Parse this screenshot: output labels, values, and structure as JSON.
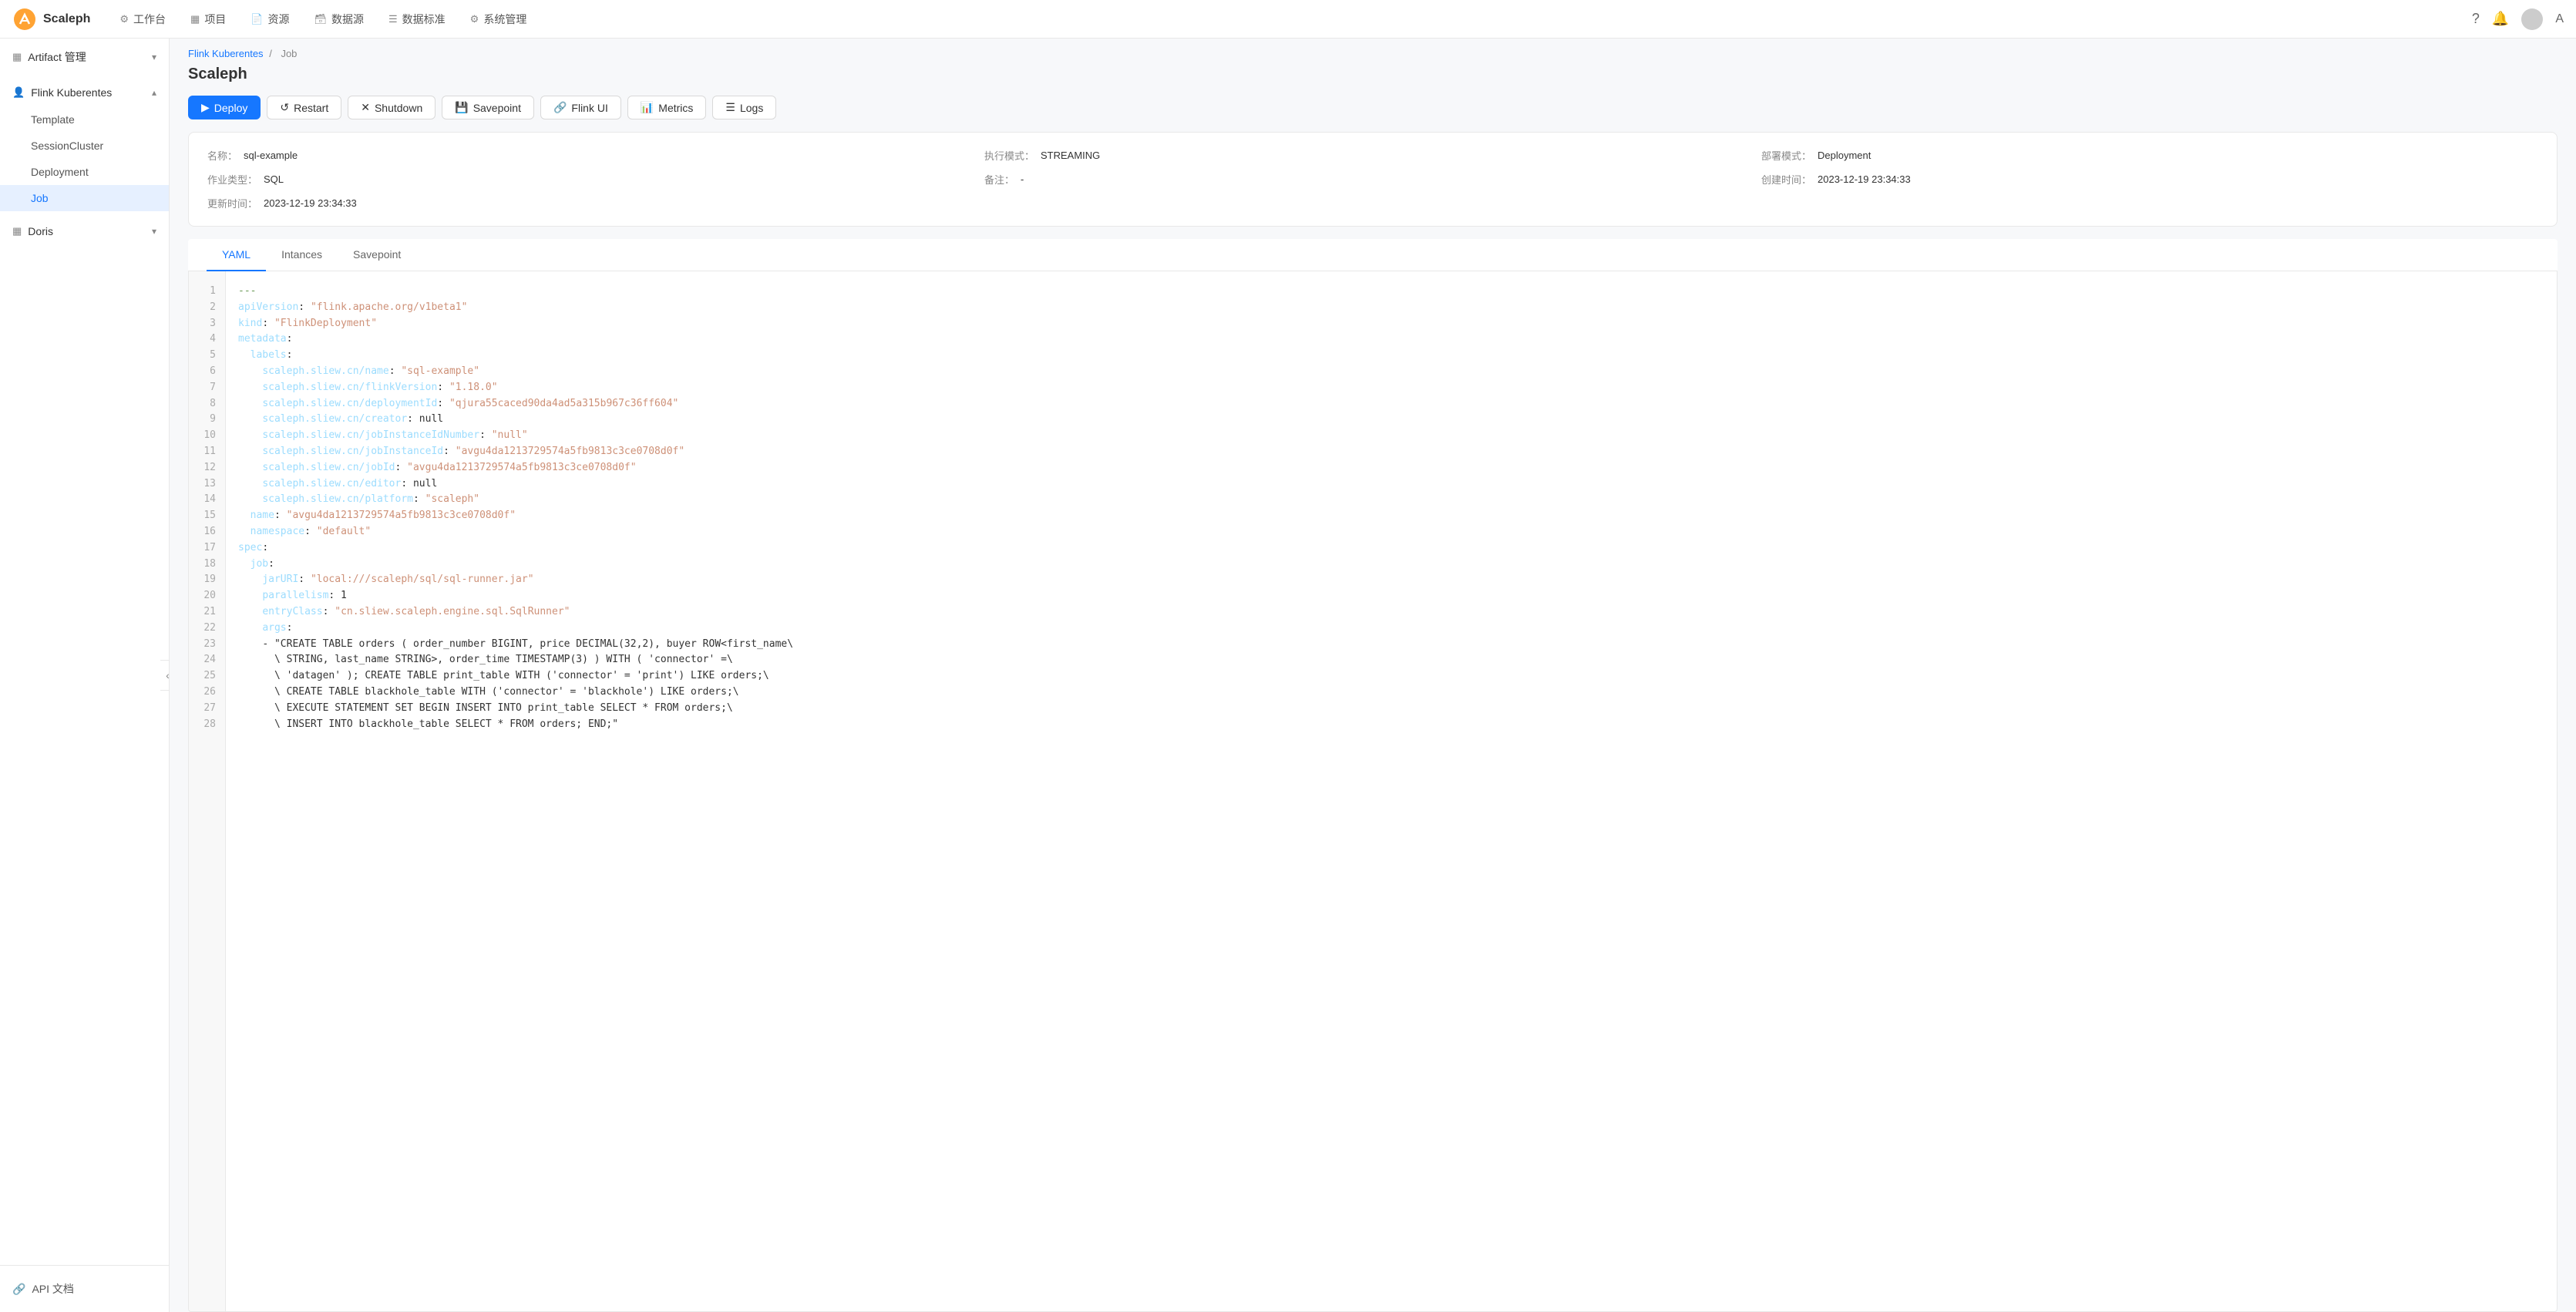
{
  "app": {
    "logo_text": "Scaleph",
    "lang": "A"
  },
  "nav": {
    "items": [
      {
        "id": "workspace",
        "icon": "⚙",
        "label": "工作台"
      },
      {
        "id": "project",
        "icon": "▦",
        "label": "项目"
      },
      {
        "id": "resource",
        "icon": "📄",
        "label": "资源"
      },
      {
        "id": "datasource",
        "icon": "🗃",
        "label": "数据源"
      },
      {
        "id": "datastandard",
        "icon": "☰",
        "label": "数据标准"
      },
      {
        "id": "sysadmin",
        "icon": "⚙",
        "label": "系统管理"
      }
    ]
  },
  "sidebar": {
    "sections": [
      {
        "id": "artifact",
        "icon": "▦",
        "label": "Artifact 管理",
        "expanded": false,
        "items": []
      },
      {
        "id": "flink-kuberentes",
        "icon": "👤",
        "label": "Flink Kuberentes",
        "expanded": true,
        "items": [
          {
            "id": "template",
            "label": "Template",
            "active": false
          },
          {
            "id": "sessioncluster",
            "label": "SessionCluster",
            "active": false
          },
          {
            "id": "deployment",
            "label": "Deployment",
            "active": false
          },
          {
            "id": "job",
            "label": "Job",
            "active": true
          }
        ]
      },
      {
        "id": "doris",
        "icon": "▦",
        "label": "Doris",
        "expanded": false,
        "items": []
      }
    ],
    "bottom": {
      "label": "API 文档",
      "icon": "🔗"
    }
  },
  "breadcrumb": {
    "parent": "Flink Kuberentes",
    "separator": "/",
    "current": "Job"
  },
  "page": {
    "title": "Scaleph"
  },
  "toolbar": {
    "deploy_label": "Deploy",
    "restart_label": "Restart",
    "shutdown_label": "Shutdown",
    "savepoint_label": "Savepoint",
    "flink_ui_label": "Flink UI",
    "metrics_label": "Metrics",
    "logs_label": "Logs"
  },
  "meta": {
    "name_label": "名称：",
    "name_value": "sql-example",
    "exec_mode_label": "执行模式：",
    "exec_mode_value": "STREAMING",
    "deploy_mode_label": "部署模式：",
    "deploy_mode_value": "Deployment",
    "job_type_label": "作业类型：",
    "job_type_value": "SQL",
    "remark_label": "备注：",
    "remark_value": "-",
    "create_time_label": "创建时间：",
    "create_time_value": "2023-12-19 23:34:33",
    "update_time_label": "更新时间：",
    "update_time_value": "2023-12-19 23:34:33"
  },
  "tabs": [
    {
      "id": "yaml",
      "label": "YAML",
      "active": true
    },
    {
      "id": "instances",
      "label": "Intances",
      "active": false
    },
    {
      "id": "savepoint",
      "label": "Savepoint",
      "active": false
    }
  ],
  "code": {
    "lines": [
      {
        "num": 1,
        "text": "---"
      },
      {
        "num": 2,
        "text": "apiVersion: \"flink.apache.org/v1beta1\""
      },
      {
        "num": 3,
        "text": "kind: \"FlinkDeployment\""
      },
      {
        "num": 4,
        "text": "metadata:"
      },
      {
        "num": 5,
        "text": "  labels:"
      },
      {
        "num": 6,
        "text": "    scaleph.sliew.cn/name: \"sql-example\""
      },
      {
        "num": 7,
        "text": "    scaleph.sliew.cn/flinkVersion: \"1.18.0\""
      },
      {
        "num": 8,
        "text": "    scaleph.sliew.cn/deploymentId: \"qjura55caced90da4ad5a315b967c36ff604\""
      },
      {
        "num": 9,
        "text": "    scaleph.sliew.cn/creator: null"
      },
      {
        "num": 10,
        "text": "    scaleph.sliew.cn/jobInstanceIdNumber: \"null\""
      },
      {
        "num": 11,
        "text": "    scaleph.sliew.cn/jobInstanceId: \"avgu4da1213729574a5fb9813c3ce0708d0f\""
      },
      {
        "num": 12,
        "text": "    scaleph.sliew.cn/jobId: \"avgu4da1213729574a5fb9813c3ce0708d0f\""
      },
      {
        "num": 13,
        "text": "    scaleph.sliew.cn/editor: null"
      },
      {
        "num": 14,
        "text": "    scaleph.sliew.cn/platform: \"scaleph\""
      },
      {
        "num": 15,
        "text": "  name: \"avgu4da1213729574a5fb9813c3ce0708d0f\""
      },
      {
        "num": 16,
        "text": "  namespace: \"default\""
      },
      {
        "num": 17,
        "text": "spec:"
      },
      {
        "num": 18,
        "text": "  job:"
      },
      {
        "num": 19,
        "text": "    jarURI: \"local:///scaleph/sql/sql-runner.jar\""
      },
      {
        "num": 20,
        "text": "    parallelism: 1"
      },
      {
        "num": 21,
        "text": "    entryClass: \"cn.sliew.scaleph.engine.sql.SqlRunner\""
      },
      {
        "num": 22,
        "text": "    args:"
      },
      {
        "num": 23,
        "text": "    - \"CREATE TABLE orders ( order_number BIGINT, price DECIMAL(32,2), buyer ROW<first_name\\"
      },
      {
        "num": 24,
        "text": "      \\ STRING, last_name STRING>, order_time TIMESTAMP(3) ) WITH ( 'connector' =\\"
      },
      {
        "num": 25,
        "text": "      \\ 'datagen' ); CREATE TABLE print_table WITH ('connector' = 'print') LIKE orders;\\"
      },
      {
        "num": 26,
        "text": "      \\ CREATE TABLE blackhole_table WITH ('connector' = 'blackhole') LIKE orders;\\"
      },
      {
        "num": 27,
        "text": "      \\ EXECUTE STATEMENT SET BEGIN INSERT INTO print_table SELECT * FROM orders;\\"
      },
      {
        "num": 28,
        "text": "      \\ INSERT INTO blackhole_table SELECT * FROM orders; END;\""
      }
    ]
  }
}
